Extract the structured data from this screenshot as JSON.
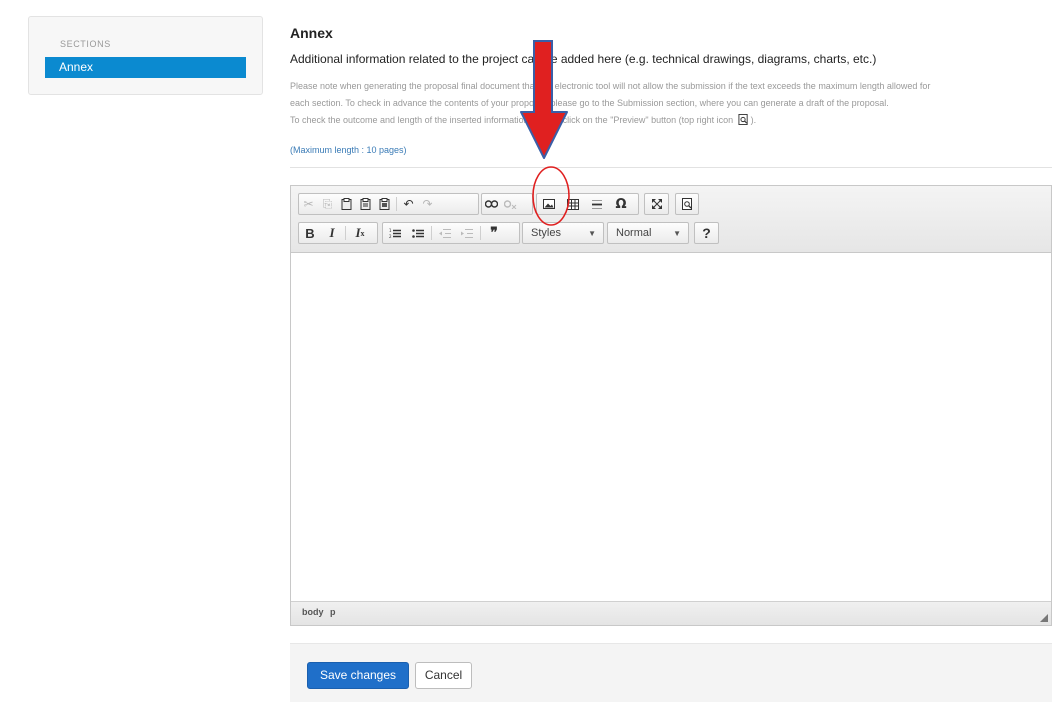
{
  "sidebar": {
    "heading": "SECTIONS",
    "items": [
      {
        "label": "Annex",
        "active": true
      }
    ]
  },
  "main": {
    "title": "Annex",
    "description": "Additional information related to the project can be added here (e.g. technical drawings, diagrams, charts, etc.)",
    "note_lines": [
      "Please note when generating the proposal final document that the electronic tool will not allow the submission if the text exceeds the maximum length allowed for",
      "each section. To check in advance the contents of your proposal, please go to the Submission section, where you can generate a draft of the proposal.",
      "To check the outcome and length of the inserted information, please click on the \"Preview\" button (top right icon"
    ],
    "note_tail": ").",
    "max_length": "(Maximum length : 10 pages)"
  },
  "editor": {
    "toolbar_row1": [
      {
        "name": "cut-icon",
        "glyph": "✂",
        "disabled": true
      },
      {
        "name": "copy-icon",
        "glyph": "⎘",
        "disabled": true
      },
      {
        "name": "paste-icon",
        "glyph": "📋",
        "disabled": false
      },
      {
        "name": "paste-text-icon",
        "glyph": "📋",
        "disabled": false
      },
      {
        "name": "paste-word-icon",
        "glyph": "📋",
        "disabled": false
      },
      {
        "name": "undo-icon",
        "glyph": "↶",
        "disabled": false
      },
      {
        "name": "redo-icon",
        "glyph": "↷",
        "disabled": true
      },
      {
        "name": "link-icon",
        "glyph": "∞",
        "disabled": false
      },
      {
        "name": "unlink-icon",
        "glyph": "⚭",
        "disabled": true
      },
      {
        "name": "image-icon",
        "glyph": "▣",
        "disabled": false
      },
      {
        "name": "table-icon",
        "glyph": "⊞",
        "disabled": false
      },
      {
        "name": "horizontal-line-icon",
        "glyph": "≡",
        "disabled": false
      },
      {
        "name": "special-char-icon",
        "glyph": "Ω",
        "disabled": false
      },
      {
        "name": "maximize-icon",
        "glyph": "⤢",
        "disabled": false
      },
      {
        "name": "preview-icon",
        "glyph": "🔍",
        "disabled": false
      }
    ],
    "toolbar_row2": [
      {
        "name": "bold-icon",
        "glyph": "B"
      },
      {
        "name": "italic-icon",
        "glyph": "I"
      },
      {
        "name": "remove-format-icon",
        "glyph": "Iₓ"
      },
      {
        "name": "numbered-list-icon",
        "glyph": "⒈"
      },
      {
        "name": "bulleted-list-icon",
        "glyph": "•"
      },
      {
        "name": "outdent-icon",
        "glyph": "⇤"
      },
      {
        "name": "indent-icon",
        "glyph": "⇥"
      },
      {
        "name": "blockquote-icon",
        "glyph": "❞"
      },
      {
        "name": "help-icon",
        "glyph": "?"
      }
    ],
    "styles_label": "Styles",
    "format_label": "Normal",
    "status_path": "body p"
  },
  "actions": {
    "save_label": "Save changes",
    "cancel_label": "Cancel"
  },
  "colors": {
    "accent": "#0b8ad0",
    "save_button": "#1f6fc9",
    "annotation": "#e02020"
  }
}
